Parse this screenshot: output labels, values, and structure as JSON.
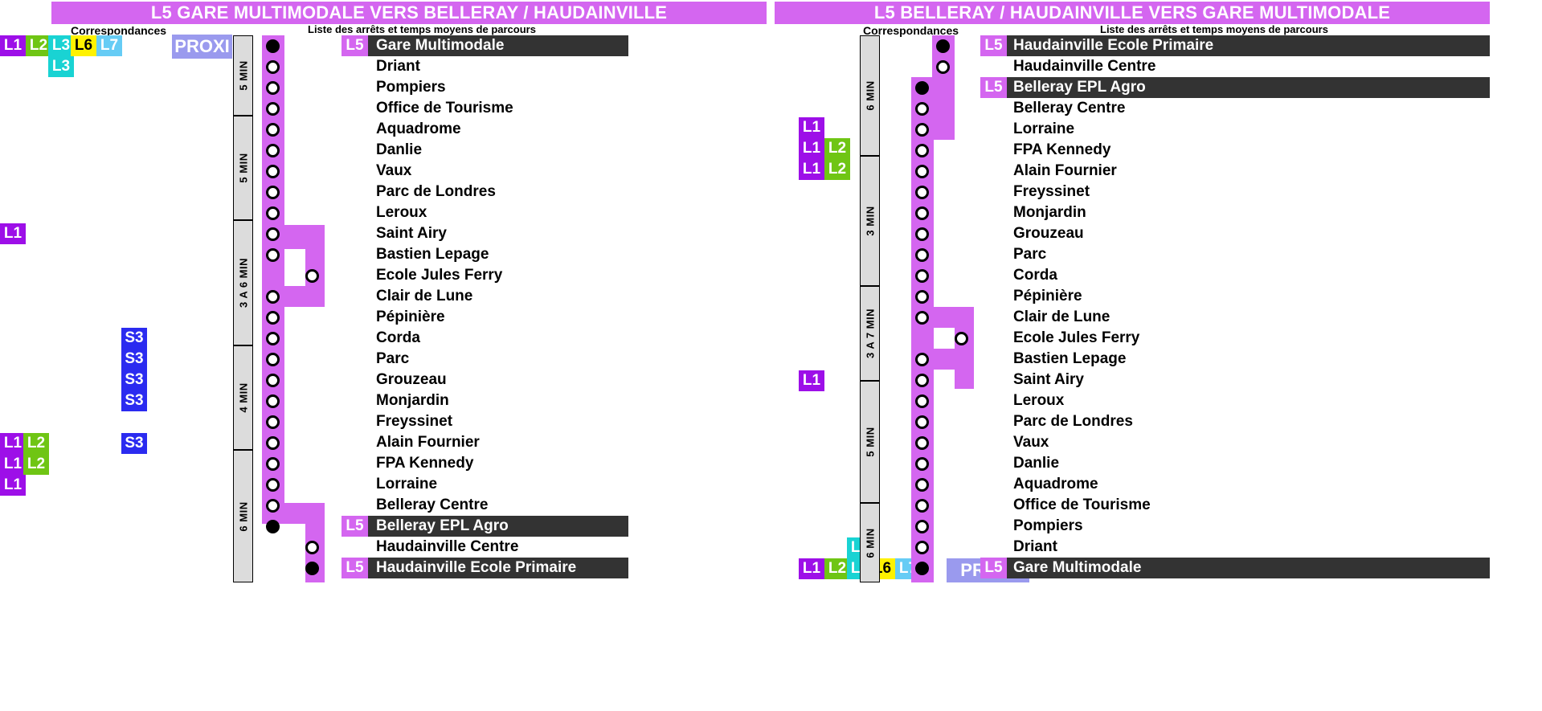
{
  "colors": {
    "L1": "#9D0FE8",
    "L2": "#6FC514",
    "L3": "#19D3D3",
    "L5": "#D466F0",
    "L6": "#FFF200",
    "L7": "#66CCF5",
    "S3": "#2B2BF0",
    "PROXI": "#9A9AEE",
    "highlight_row": "#333333",
    "trunk": "#D466F0",
    "time_block": "#DCDCDC"
  },
  "panels": [
    {
      "id": "left",
      "title": "L5 GARE MULTIMODALE VERS BELLERAY / HAUDAINVILLE",
      "correspondances_label": "Correspondances",
      "list_label": "Liste des arrêts et temps moyens de parcours",
      "proxi_label": "PROXI",
      "time_blocks": [
        {
          "label": "5 MIN"
        },
        {
          "label": "5 MIN"
        },
        {
          "label": "3 A 6 MIN"
        },
        {
          "label": "4 MIN"
        },
        {
          "label": "6 MIN"
        }
      ],
      "stops": [
        {
          "name": "Gare Multimodale",
          "terminus": true,
          "highlight": true,
          "tag": "L5",
          "corr": [
            "L1",
            "L2",
            "L3",
            "L6",
            "L7"
          ],
          "corr2": [
            "L3"
          ]
        },
        {
          "name": "Driant",
          "terminus": false,
          "highlight": false
        },
        {
          "name": "Pompiers",
          "terminus": false,
          "highlight": false
        },
        {
          "name": "Office de Tourisme",
          "terminus": false,
          "highlight": false
        },
        {
          "name": "Aquadrome",
          "terminus": false,
          "highlight": false
        },
        {
          "name": "Danlie",
          "terminus": false,
          "highlight": false
        },
        {
          "name": "Vaux",
          "terminus": false,
          "highlight": false
        },
        {
          "name": "Parc de Londres",
          "terminus": false,
          "highlight": false
        },
        {
          "name": "Leroux",
          "terminus": false,
          "highlight": false
        },
        {
          "name": "Saint Airy",
          "terminus": false,
          "highlight": false,
          "corr": [
            "L1"
          ]
        },
        {
          "name": "Bastien Lepage",
          "terminus": false,
          "highlight": false
        },
        {
          "name": "Ecole Jules Ferry",
          "terminus": false,
          "highlight": false,
          "branch": true
        },
        {
          "name": "Clair de Lune",
          "terminus": false,
          "highlight": false
        },
        {
          "name": "Pépinière",
          "terminus": false,
          "highlight": false
        },
        {
          "name": "Corda",
          "terminus": false,
          "highlight": false
        },
        {
          "name": "Parc",
          "terminus": false,
          "highlight": false,
          "corr": [
            "S3"
          ]
        },
        {
          "name": "Grouzeau",
          "terminus": false,
          "highlight": false,
          "corr": [
            "S3"
          ]
        },
        {
          "name": "Monjardin",
          "terminus": false,
          "highlight": false,
          "corr": [
            "S3"
          ]
        },
        {
          "name": "Freyssinet",
          "terminus": false,
          "highlight": false,
          "corr": [
            "S3"
          ]
        },
        {
          "name": "Alain Fournier",
          "terminus": false,
          "highlight": false
        },
        {
          "name": "FPA Kennedy",
          "terminus": false,
          "highlight": false,
          "corr": [
            "L1",
            "L2"
          ],
          "corrS": [
            "S3"
          ]
        },
        {
          "name": "Lorraine",
          "terminus": false,
          "highlight": false,
          "corr": [
            "L1",
            "L2"
          ]
        },
        {
          "name": "Belleray Centre",
          "terminus": false,
          "highlight": false,
          "corr": [
            "L1"
          ]
        },
        {
          "name": "Belleray EPL Agro",
          "terminus": true,
          "highlight": true,
          "tag": "L5"
        },
        {
          "name": "Haudainville Centre",
          "terminus": false,
          "highlight": false,
          "branch": true
        },
        {
          "name": "Haudainville Ecole Primaire",
          "terminus": true,
          "highlight": true,
          "tag": "L5",
          "branch": true
        }
      ]
    },
    {
      "id": "right",
      "title": "L5 BELLERAY / HAUDAINVILLE VERS GARE MULTIMODALE",
      "correspondances_label": "Correspondances",
      "list_label": "Liste des arrêts et temps moyens de parcours",
      "proxi_label": "PROXI",
      "time_blocks": [
        {
          "label": "6 MIN"
        },
        {
          "label": "3 MIN"
        },
        {
          "label": "3 A 7 MIN"
        },
        {
          "label": "5 MIN"
        },
        {
          "label": "6 MIN"
        }
      ],
      "stops": [
        {
          "name": "Haudainville Ecole Primaire",
          "terminus": true,
          "highlight": true,
          "tag": "L5",
          "branch": true
        },
        {
          "name": "Haudainville Centre",
          "terminus": false,
          "highlight": false,
          "branch": true
        },
        {
          "name": "Belleray EPL Agro",
          "terminus": true,
          "highlight": true,
          "tag": "L5"
        },
        {
          "name": "Belleray Centre",
          "terminus": false,
          "highlight": false,
          "corr": [
            "L1"
          ]
        },
        {
          "name": "Lorraine",
          "terminus": false,
          "highlight": false,
          "corr": [
            "L1",
            "L2"
          ]
        },
        {
          "name": "FPA Kennedy",
          "terminus": false,
          "highlight": false,
          "corr": [
            "L1",
            "L2"
          ]
        },
        {
          "name": "Alain Fournier",
          "terminus": false,
          "highlight": false
        },
        {
          "name": "Freyssinet",
          "terminus": false,
          "highlight": false
        },
        {
          "name": "Monjardin",
          "terminus": false,
          "highlight": false
        },
        {
          "name": "Grouzeau",
          "terminus": false,
          "highlight": false
        },
        {
          "name": "Parc",
          "terminus": false,
          "highlight": false
        },
        {
          "name": "Corda",
          "terminus": false,
          "highlight": false
        },
        {
          "name": "Pépinière",
          "terminus": false,
          "highlight": false
        },
        {
          "name": "Clair de Lune",
          "terminus": false,
          "highlight": false
        },
        {
          "name": "Ecole Jules Ferry",
          "terminus": false,
          "highlight": false,
          "branch": true
        },
        {
          "name": "Bastien Lepage",
          "terminus": false,
          "highlight": false
        },
        {
          "name": "Saint Airy",
          "terminus": false,
          "highlight": false,
          "corr": [
            "L1"
          ]
        },
        {
          "name": "Leroux",
          "terminus": false,
          "highlight": false
        },
        {
          "name": "Parc de Londres",
          "terminus": false,
          "highlight": false
        },
        {
          "name": "Vaux",
          "terminus": false,
          "highlight": false
        },
        {
          "name": "Danlie",
          "terminus": false,
          "highlight": false
        },
        {
          "name": "Aquadrome",
          "terminus": false,
          "highlight": false
        },
        {
          "name": "Office de Tourisme",
          "terminus": false,
          "highlight": false
        },
        {
          "name": "Pompiers",
          "terminus": false,
          "highlight": false
        },
        {
          "name": "Driant",
          "terminus": false,
          "highlight": false
        },
        {
          "name": "Gare Multimodale",
          "terminus": true,
          "highlight": true,
          "tag": "L5",
          "corr": [
            "L1",
            "L2",
            "L3",
            "L6",
            "L7"
          ],
          "corr2": [
            "L3"
          ]
        }
      ]
    }
  ]
}
